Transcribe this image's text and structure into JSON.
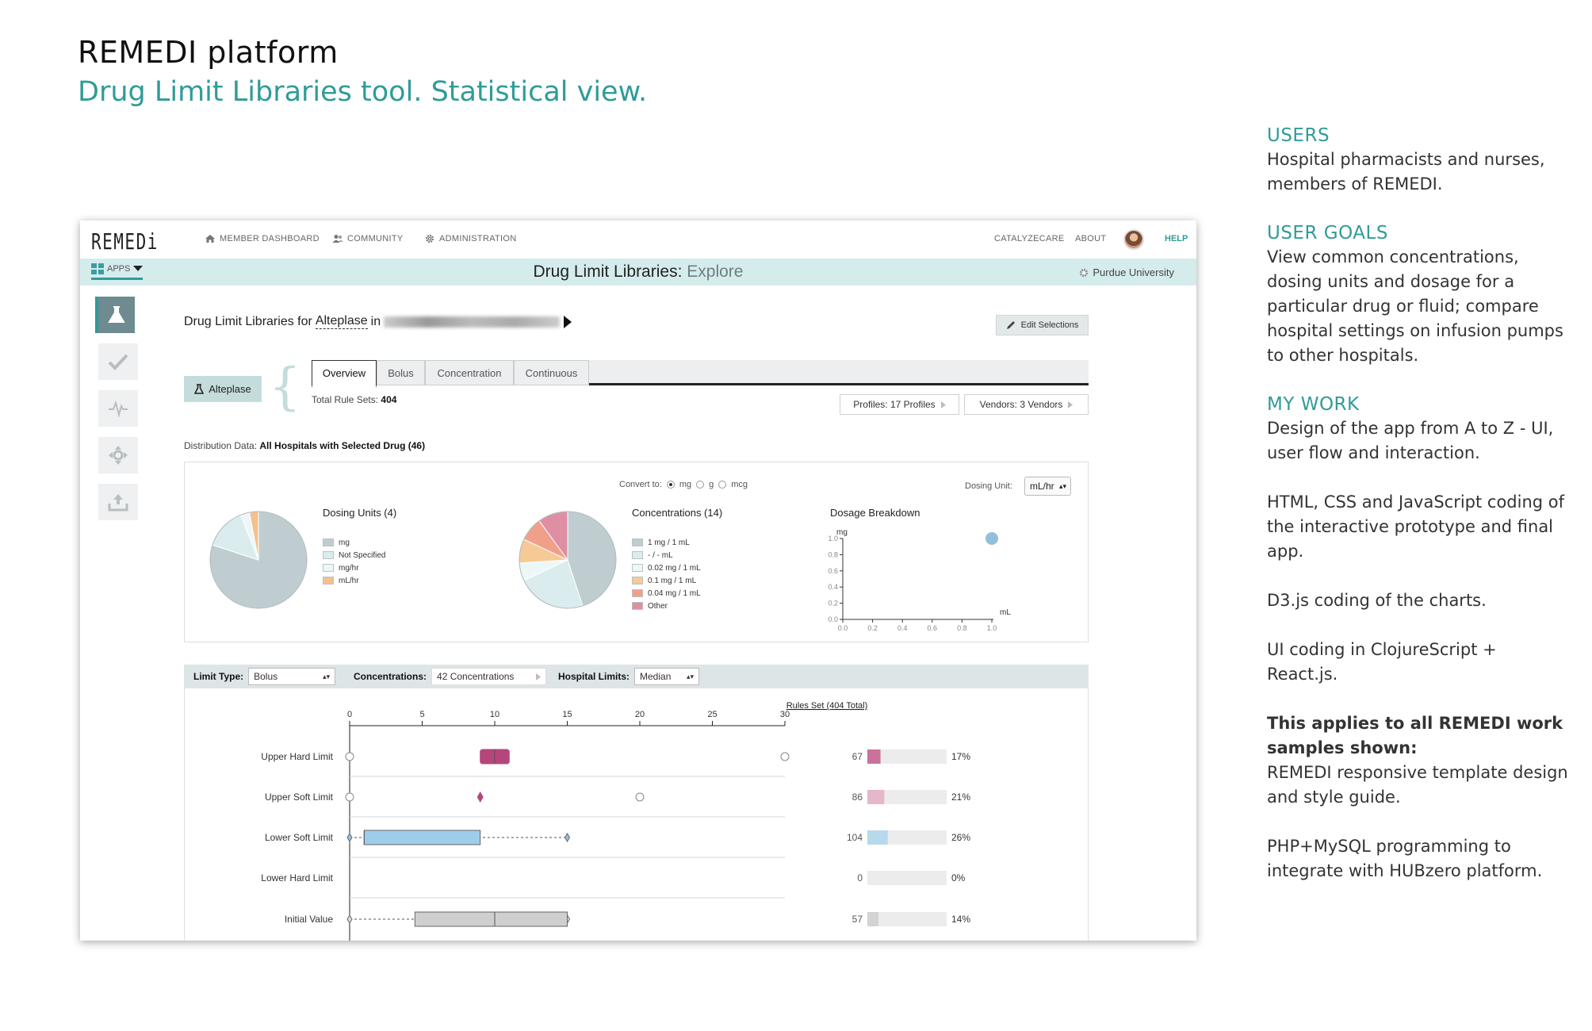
{
  "doc": {
    "title": "REMEDI platform",
    "subtitle": "Drug Limit Libraries tool. Statistical view."
  },
  "sidebar_text": {
    "users_heading": "USERS",
    "users_text": "Hospital pharmacists and nurses, members of REMEDI.",
    "goals_heading": "USER GOALS",
    "goals_text": "View common concentrations, dosing units and dosage for a particular drug or fluid; compare hospital settings on infusion pumps to other hospitals.",
    "work_heading": "MY WORK",
    "work_text_1": "Design of the app from A to Z - UI, user flow and interaction.",
    "work_text_2": "HTML, CSS and JavaScript coding of the interactive prototype and final app.",
    "work_text_3": "D3.js coding of the charts.",
    "work_text_4": "UI coding in ClojureScript + React.js.",
    "applies_bold": "This applies to all REMEDI work samples shown:",
    "applies_text": "REMEDI responsive template design and style guide.",
    "work_text_5": "PHP+MySQL programming to integrate with HUBzero platform."
  },
  "app": {
    "logo": "REMEDi",
    "nav": {
      "member_dashboard": "MEMBER DASHBOARD",
      "community": "COMMUNITY",
      "administration": "ADMINISTRATION",
      "catalyzecare": "CATALYZECARE",
      "about": "ABOUT",
      "help": "HELP"
    },
    "apps_label": "APPS",
    "heading_main": "Drug Limit Libraries:",
    "heading_sub": "Explore",
    "organization": "Purdue University",
    "drug_header_prefix": "Drug Limit Libraries for",
    "drug_name": "Alteplase",
    "drug_header_in": "in",
    "edit_button": "Edit Selections",
    "drug_chip": "Alteplase",
    "tabs": [
      "Overview",
      "Bolus",
      "Concentration",
      "Continuous"
    ],
    "total_rule_sets_label": "Total Rule Sets:",
    "total_rule_sets_value": "404",
    "profiles": "Profiles: 17 Profiles",
    "vendors": "Vendors: 3 Vendors",
    "dist_label": "Distribution Data:",
    "dist_value": "All Hospitals with Selected Drug (46)",
    "convert_to": "Convert to:",
    "convert_options": [
      "mg",
      "g",
      "mcg"
    ],
    "dosing_unit_label": "Dosing Unit:",
    "dosing_unit_value": "mL/hr"
  },
  "chart_data": [
    {
      "type": "pie",
      "title": "Dosing Units (4)",
      "labels": [
        "mg",
        "Not Specified",
        "mg/hr",
        "mL/hr"
      ],
      "values": [
        80,
        14,
        3,
        3
      ],
      "colors": [
        "#c0cdd0",
        "#dbecee",
        "#eef7f8",
        "#f4c08e"
      ]
    },
    {
      "type": "pie",
      "title": "Concentrations (14)",
      "labels": [
        "1 mg / 1 mL",
        "- / - mL",
        "0.02 mg / 1 mL",
        "0.1 mg / 1 mL",
        "0.04 mg / 1 mL",
        "Other"
      ],
      "values": [
        45,
        23,
        6,
        8,
        8,
        10
      ],
      "colors": [
        "#c0cdd0",
        "#dbecee",
        "#eef7f8",
        "#f7c996",
        "#f0a08a",
        "#de8fa4"
      ]
    },
    {
      "type": "scatter",
      "title": "Dosage Breakdown",
      "ylabel": "mg",
      "xlabel": "mL",
      "xlim": [
        0,
        1
      ],
      "ylim": [
        0,
        1
      ],
      "xticks": [
        "0.0",
        "0.2",
        "0.4",
        "0.6",
        "0.8",
        "1.0"
      ],
      "yticks": [
        "0.0",
        "0.2",
        "0.4",
        "0.6",
        "0.8",
        "1.0"
      ],
      "points": [
        {
          "x": 1.0,
          "y": 1.0
        }
      ]
    },
    {
      "type": "box",
      "title": "",
      "xlim": [
        0,
        30
      ],
      "xticks": [
        "0",
        "5",
        "10",
        "15",
        "20",
        "25",
        "30"
      ],
      "rows": [
        {
          "label": "Upper Hard Limit",
          "min": 0,
          "q1": 9,
          "median": 10,
          "q3": 11,
          "max": 30,
          "color": "#b5467b",
          "whisker": "none",
          "outliers": [
            0,
            30
          ]
        },
        {
          "label": "Upper Soft Limit",
          "min": 9,
          "q1": 9,
          "median": 9,
          "q3": 9,
          "max": 9,
          "color": "#b5467b",
          "whisker": "none",
          "outliers": [
            0,
            20
          ]
        },
        {
          "label": "Lower Soft Limit",
          "min": 0,
          "q1": 1,
          "median": 1,
          "q3": 9,
          "max": 15,
          "color": "#9dcdea",
          "whisker": "dashed",
          "outliers": []
        },
        {
          "label": "Lower Hard Limit",
          "empty": true
        },
        {
          "label": "Initial Value",
          "min": 0,
          "q1": 4.5,
          "median": 10,
          "q3": 15,
          "max": 15,
          "color": "#cfcfcf",
          "whisker": "dashed",
          "outliers": []
        }
      ]
    },
    {
      "type": "bar",
      "title": "Rules Set (404 Total)",
      "categories": [
        "Upper Hard Limit",
        "Upper Soft Limit",
        "Lower Soft Limit",
        "Lower Hard Limit",
        "Initial Value"
      ],
      "values": [
        67,
        86,
        104,
        0,
        57
      ],
      "percent_labels": [
        "17%",
        "21%",
        "26%",
        "0%",
        "14%"
      ],
      "colors": [
        "#c9729a",
        "#e6b6cb",
        "#b6d9ec",
        "#e8e8e8",
        "#d3d3d3"
      ]
    }
  ],
  "filters": {
    "limit_type_label": "Limit Type:",
    "limit_type_value": "Bolus",
    "concentrations_label": "Concentrations:",
    "concentrations_value": "42 Concentrations",
    "hospital_limits_label": "Hospital Limits:",
    "hospital_limits_value": "Median"
  }
}
